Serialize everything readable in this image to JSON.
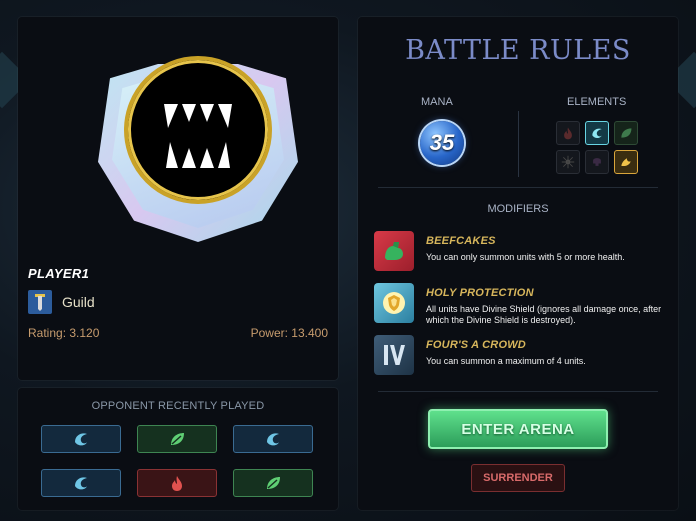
{
  "player": {
    "name": "PLAYER1",
    "guild": "Guild",
    "rating": "Rating: 3.120",
    "power": "Power: 13.400"
  },
  "opponent": {
    "title": "OPPONENT RECENTLY PLAYED",
    "recent_elements": [
      "water",
      "earth",
      "water",
      "water",
      "fire",
      "earth"
    ]
  },
  "rules": {
    "title": "BATTLE RULES",
    "mana_label": "MANA",
    "mana_value": "35",
    "elements_label": "ELEMENTS",
    "elements": [
      {
        "name": "fire",
        "active": false
      },
      {
        "name": "water",
        "active": true
      },
      {
        "name": "earth",
        "active": false
      },
      {
        "name": "life",
        "active": false
      },
      {
        "name": "death",
        "active": false
      },
      {
        "name": "dragon",
        "active": true
      }
    ],
    "modifiers_label": "MODIFIERS",
    "modifiers": [
      {
        "name": "BEEFCAKES",
        "description": "You can only summon units with 5 or more health.",
        "icon": "flexing-arm-icon"
      },
      {
        "name": "HOLY PROTECTION",
        "description": "All units have Divine Shield (ignores all damage once, after which the Divine Shield is destroyed).",
        "icon": "divine-shield-icon"
      },
      {
        "name": "FOUR'S A CROWD",
        "description": "You can summon a maximum of 4 units.",
        "icon": "roman-four-icon"
      }
    ],
    "enter_button": "ENTER ARENA",
    "surrender_button": "SURRENDER"
  },
  "colors": {
    "accent_title": "#7b8bc8",
    "gold": "#d7b65c",
    "enter_green": "#3fbf70",
    "surrender_red": "#d86a6a"
  }
}
